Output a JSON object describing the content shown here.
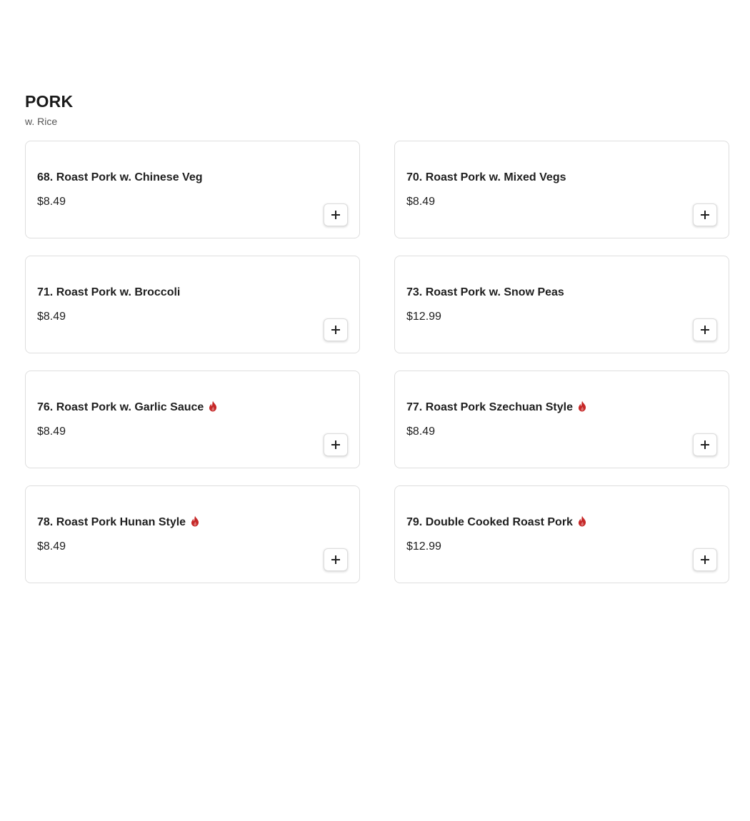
{
  "section": {
    "title": "PORK",
    "subtitle": "w. Rice"
  },
  "colors": {
    "spicy": "#c62828",
    "border": "#dedede"
  },
  "items": [
    {
      "name": "68. Roast Pork w. Chinese Veg",
      "price": "$8.49",
      "spicy": false,
      "add_icon": "plus-icon"
    },
    {
      "name": "70. Roast Pork w. Mixed Vegs",
      "price": "$8.49",
      "spicy": false,
      "add_icon": "plus-icon"
    },
    {
      "name": "71. Roast Pork w. Broccoli",
      "price": "$8.49",
      "spicy": false,
      "add_icon": "plus-icon"
    },
    {
      "name": "73. Roast Pork w. Snow Peas",
      "price": "$12.99",
      "spicy": false,
      "add_icon": "plus-icon"
    },
    {
      "name": "76. Roast Pork w. Garlic Sauce",
      "price": "$8.49",
      "spicy": true,
      "spicy_icon": "flame-icon",
      "add_icon": "plus-icon"
    },
    {
      "name": "77. Roast Pork Szechuan Style",
      "price": "$8.49",
      "spicy": true,
      "spicy_icon": "flame-icon",
      "add_icon": "plus-icon"
    },
    {
      "name": "78. Roast Pork Hunan Style",
      "price": "$8.49",
      "spicy": true,
      "spicy_icon": "flame-icon",
      "add_icon": "plus-icon"
    },
    {
      "name": "79. Double Cooked Roast Pork",
      "price": "$12.99",
      "spicy": true,
      "spicy_icon": "flame-icon",
      "add_icon": "plus-icon"
    }
  ]
}
